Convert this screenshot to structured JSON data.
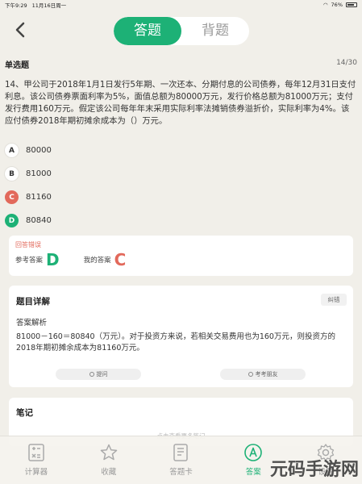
{
  "status_bar": {
    "time": "下午9:29",
    "date": "11月16日周一",
    "battery": "76%"
  },
  "header": {
    "tabs": [
      {
        "label": "答题",
        "active": true
      },
      {
        "label": "背题",
        "active": false
      }
    ]
  },
  "question": {
    "type": "单选题",
    "counter": "14/30",
    "text": "14、甲公司于2018年1月1日发行5年期、一次还本、分期付息的公司债券，每年12月31日支付利息。该公司债券票面利率为5%，面值总额为80000万元，发行价格总额为81000万元；支付发行费用160万元。假定该公司每年年末采用实际利率法摊销债券溢折价，实际利率为4%。该应付债券2018年期初摊余成本为（）万元。",
    "options": [
      {
        "letter": "A",
        "text": "80000",
        "state": "normal"
      },
      {
        "letter": "B",
        "text": "81000",
        "state": "normal"
      },
      {
        "letter": "C",
        "text": "81160",
        "state": "wrong"
      },
      {
        "letter": "D",
        "text": "80840",
        "state": "right"
      }
    ]
  },
  "result": {
    "title": "回答错误",
    "ref_label": "参考答案",
    "ref_answer": "D",
    "my_label": "我的答案",
    "my_answer": "C"
  },
  "detail": {
    "title": "题目详解",
    "report_label": "纠错",
    "analysis_title": "答案解析",
    "analysis_text": "81000－160＝80840（万元）。对于投资方来说，若相关交易费用也为160万元，则投资方的2018年期初摊余成本为81160万元。",
    "ask_label": "提问",
    "exam_label": "考考朋友"
  },
  "notes": {
    "title": "笔记",
    "hint": "点击查看更多笔记"
  },
  "tabbar": [
    {
      "label": "计算器",
      "icon": "calculator-icon",
      "active": false
    },
    {
      "label": "收藏",
      "icon": "star-icon",
      "active": false
    },
    {
      "label": "答题卡",
      "icon": "answer-card-icon",
      "active": false
    },
    {
      "label": "答案",
      "icon": "answer-icon",
      "active": true
    },
    {
      "label": "设置",
      "icon": "gear-icon",
      "active": false
    }
  ],
  "watermark": "元码手游网",
  "colors": {
    "accent": "#1db176",
    "wrong": "#e2695b",
    "background": "#f1efe9"
  }
}
